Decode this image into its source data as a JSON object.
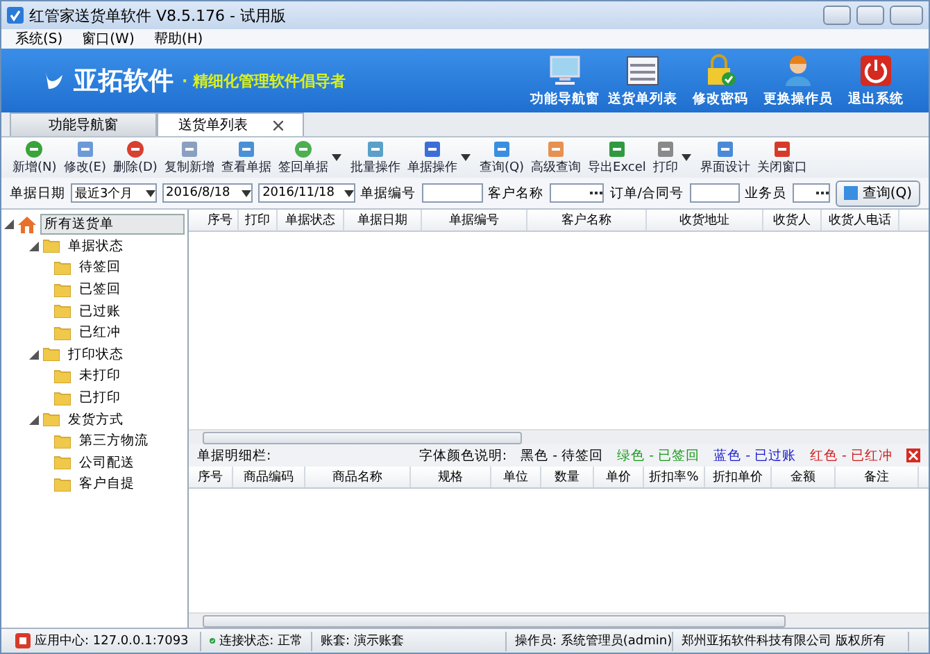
{
  "window": {
    "title": "红管家送货单软件 V8.5.176 - 试用版"
  },
  "menu": [
    "系统(S)",
    "窗口(W)",
    "帮助(H)"
  ],
  "banner": {
    "logo": "亚拓软件",
    "slogan": "· 精细化管理软件倡导者",
    "actions": [
      {
        "label": "功能导航窗",
        "kind": "monitor"
      },
      {
        "label": "送货单列表",
        "kind": "list"
      },
      {
        "label": "修改密码",
        "kind": "lock"
      },
      {
        "label": "更换操作员",
        "kind": "user"
      },
      {
        "label": "退出系统",
        "kind": "power"
      }
    ]
  },
  "tabs": [
    {
      "label": "功能导航窗",
      "selected": false,
      "closable": false
    },
    {
      "label": "送货单列表",
      "selected": true,
      "closable": true
    }
  ],
  "toolbar": [
    {
      "label": "新增(N)",
      "dropdown": false
    },
    {
      "label": "修改(E)",
      "dropdown": false
    },
    {
      "label": "删除(D)",
      "dropdown": false
    },
    {
      "label": "复制新增",
      "dropdown": false
    },
    {
      "label": "查看单据",
      "dropdown": false
    },
    {
      "label": "签回单据",
      "dropdown": true
    },
    {
      "label": "批量操作",
      "dropdown": false
    },
    {
      "label": "单据操作",
      "dropdown": true
    },
    {
      "label": "查询(Q)",
      "dropdown": false
    },
    {
      "label": "高级查询",
      "dropdown": false
    },
    {
      "label": "导出Excel",
      "dropdown": false
    },
    {
      "label": "打印",
      "dropdown": true
    },
    {
      "label": "界面设计",
      "dropdown": false
    },
    {
      "label": "关闭窗口",
      "dropdown": false
    }
  ],
  "filters": {
    "date_label": "单据日期",
    "range": "最近3个月",
    "date_from": "2016/8/18",
    "date_to": "2016/11/18",
    "number_label": "单据编号",
    "customer_label": "客户名称",
    "order_label": "订单/合同号",
    "salesman_label": "业务员",
    "search_button": "查询(Q)"
  },
  "tree": {
    "label": "所有送货单",
    "selected": true,
    "expanded": true,
    "children": [
      {
        "label": "单据状态",
        "expanded": true,
        "selected": false,
        "children": [
          {
            "label": "待签回",
            "selected": false
          },
          {
            "label": "已签回",
            "selected": false
          },
          {
            "label": "已过账",
            "selected": false
          },
          {
            "label": "已红冲",
            "selected": false
          }
        ]
      },
      {
        "label": "打印状态",
        "expanded": true,
        "selected": false,
        "children": [
          {
            "label": "未打印",
            "selected": false
          },
          {
            "label": "已打印",
            "selected": false
          }
        ]
      },
      {
        "label": "发货方式",
        "expanded": true,
        "selected": false,
        "children": [
          {
            "label": "第三方物流",
            "selected": false
          },
          {
            "label": "公司配送",
            "selected": false
          },
          {
            "label": "客户自提",
            "selected": false
          }
        ]
      }
    ]
  },
  "table": {
    "columns": [
      "序号",
      "打印",
      "单据状态",
      "单据日期",
      "单据编号",
      "客户名称",
      "收货地址",
      "收货人",
      "收货人电话"
    ]
  },
  "detail": {
    "title": "单据明细栏:",
    "legend_label": "字体颜色说明:",
    "legend": [
      {
        "label": "黑色 - 待签回",
        "color": "#000000"
      },
      {
        "label": "绿色 - 已签回",
        "color": "#1a9a1a"
      },
      {
        "label": "蓝色 - 已过账",
        "color": "#1a1ad0"
      },
      {
        "label": "红色 - 已红冲",
        "color": "#d01a1a"
      }
    ],
    "columns": [
      "序号",
      "商品编码",
      "商品名称",
      "规格",
      "单位",
      "数量",
      "单价",
      "折扣率%",
      "折扣单价",
      "金额",
      "备注"
    ]
  },
  "status_bar": {
    "app_center": "应用中心: 127.0.0.1:7093",
    "connection": "连接状态: 正常",
    "account": "账套: 演示账套",
    "operator": "操作员: 系统管理员(admin)",
    "copyright": "郑州亚拓软件科技有限公司 版权所有"
  }
}
